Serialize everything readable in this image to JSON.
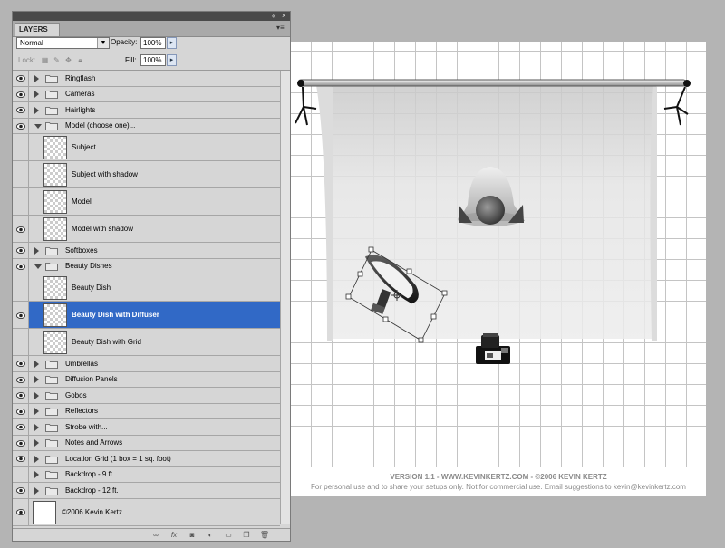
{
  "panel": {
    "title": "LAYERS",
    "blend_mode": "Normal",
    "opacity_label": "Opacity:",
    "opacity_value": "100%",
    "lock_label": "Lock:",
    "fill_label": "Fill:",
    "fill_value": "100%"
  },
  "layers": [
    {
      "name": "Ringflash",
      "type": "group",
      "visible": true,
      "expanded": false
    },
    {
      "name": "Cameras",
      "type": "group",
      "visible": true,
      "expanded": false
    },
    {
      "name": "Hairlights",
      "type": "group",
      "visible": true,
      "expanded": false
    },
    {
      "name": "Model (choose one)...",
      "type": "group",
      "visible": true,
      "expanded": true
    },
    {
      "name": "Subject",
      "type": "layer",
      "visible": false
    },
    {
      "name": "Subject with shadow",
      "type": "layer",
      "visible": false
    },
    {
      "name": "Model",
      "type": "layer",
      "visible": false
    },
    {
      "name": "Model with shadow",
      "type": "layer",
      "visible": true
    },
    {
      "name": "Softboxes",
      "type": "group",
      "visible": true,
      "expanded": false
    },
    {
      "name": "Beauty Dishes",
      "type": "group",
      "visible": true,
      "expanded": true
    },
    {
      "name": "Beauty Dish",
      "type": "layer",
      "visible": false
    },
    {
      "name": "Beauty Dish with Diffuser",
      "type": "layer",
      "visible": true,
      "selected": true
    },
    {
      "name": "Beauty Dish with Grid",
      "type": "layer",
      "visible": false
    },
    {
      "name": "Umbrellas",
      "type": "group",
      "visible": true,
      "expanded": false
    },
    {
      "name": "Diffusion Panels",
      "type": "group",
      "visible": true,
      "expanded": false
    },
    {
      "name": "Gobos",
      "type": "group",
      "visible": true,
      "expanded": false
    },
    {
      "name": "Reflectors",
      "type": "group",
      "visible": true,
      "expanded": false
    },
    {
      "name": "Strobe with...",
      "type": "group",
      "visible": true,
      "expanded": false
    },
    {
      "name": "Notes and Arrows",
      "type": "group",
      "visible": true,
      "expanded": false
    },
    {
      "name": "Location Grid (1 box = 1 sq. foot)",
      "type": "group",
      "visible": true,
      "expanded": false
    },
    {
      "name": "Backdrop - 9 ft.",
      "type": "group",
      "visible": false,
      "expanded": false
    },
    {
      "name": "Backdrop - 12 ft.",
      "type": "group",
      "visible": true,
      "expanded": false
    },
    {
      "name": "©2006 Kevin Kertz",
      "type": "background",
      "visible": true
    }
  ],
  "canvas": {
    "version_line": "VERSION 1.1  -  WWW.KEVINKERTZ.COM  -  ©2006 KEVIN KERTZ",
    "usage_line": "For personal use and to share your setups only. Not for commercial use.  Email suggestions to kevin@kevinkertz.com"
  },
  "icons": {
    "collapse": "double-chevron-left-icon",
    "close": "close-icon",
    "panel_menu": "panel-menu-icon",
    "footer": [
      "link-layers-icon",
      "fx-icon",
      "layer-mask-icon",
      "adjustment-layer-icon",
      "new-group-icon",
      "new-layer-icon",
      "trash-icon"
    ]
  },
  "colors": {
    "selection": "#3169c6",
    "panel_bg": "#d6d6d6",
    "workspace_bg": "#b4b4b4"
  }
}
